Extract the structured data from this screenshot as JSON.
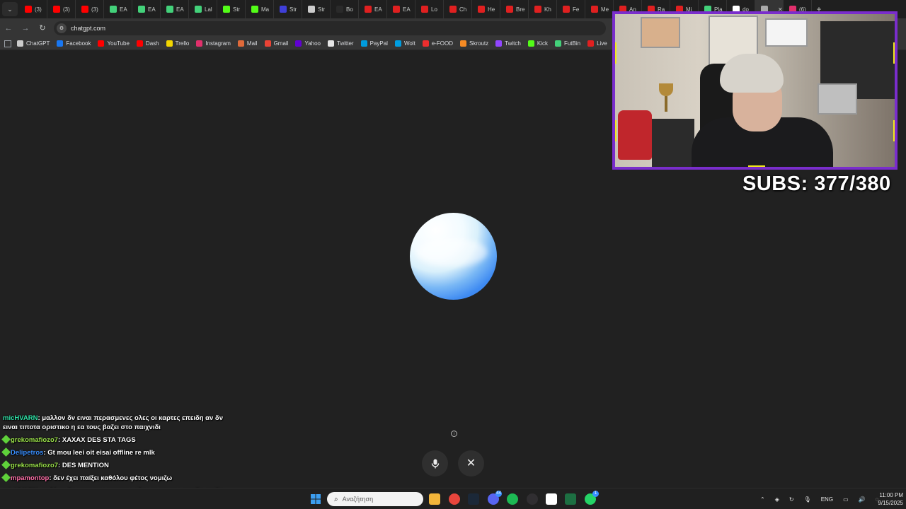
{
  "browser": {
    "tabs": [
      {
        "label": "(3)",
        "color": "#ff0000",
        "icon": "youtube-icon"
      },
      {
        "label": "(3)",
        "color": "#ff0000",
        "icon": "youtube-icon"
      },
      {
        "label": "(3)",
        "color": "#ff0000",
        "icon": "youtube-icon"
      },
      {
        "label": "EA",
        "color": "#43d17a",
        "icon": "futbin-icon"
      },
      {
        "label": "EA",
        "color": "#43d17a",
        "icon": "futbin-icon"
      },
      {
        "label": "EA",
        "color": "#43d17a",
        "icon": "futbin-icon"
      },
      {
        "label": "Lal",
        "color": "#43d17a",
        "icon": "futbin-icon"
      },
      {
        "label": "Str",
        "color": "#53fc18",
        "icon": "kick-icon"
      },
      {
        "label": "Ma",
        "color": "#53fc18",
        "icon": "kick-icon"
      },
      {
        "label": "Str",
        "color": "#3f3fd8",
        "icon": "stream-icon"
      },
      {
        "label": "Str",
        "color": "#cccccc",
        "icon": "stream-icon"
      },
      {
        "label": "Bo",
        "color": "#2a2a2a",
        "icon": "blank-icon"
      },
      {
        "label": "EA",
        "color": "#e02020",
        "icon": "ea-icon"
      },
      {
        "label": "EA",
        "color": "#e02020",
        "icon": "ea-icon"
      },
      {
        "label": "Lo",
        "color": "#e02020",
        "icon": "ea-icon"
      },
      {
        "label": "Ch",
        "color": "#e02020",
        "icon": "ea-icon"
      },
      {
        "label": "He",
        "color": "#e02020",
        "icon": "ea-icon"
      },
      {
        "label": "Bre",
        "color": "#e02020",
        "icon": "ea-icon"
      },
      {
        "label": "Kh",
        "color": "#e02020",
        "icon": "ea-icon"
      },
      {
        "label": "Fe",
        "color": "#e02020",
        "icon": "ea-icon"
      },
      {
        "label": "Me",
        "color": "#e02020",
        "icon": "ea-icon"
      },
      {
        "label": "An",
        "color": "#e02020",
        "icon": "ea-icon"
      },
      {
        "label": "Ra",
        "color": "#e02020",
        "icon": "ea-icon"
      },
      {
        "label": "Mi",
        "color": "#e02020",
        "icon": "ea-icon"
      },
      {
        "label": "Pla",
        "color": "#43d17a",
        "icon": "futbin-icon"
      },
      {
        "label": "do",
        "color": "#ffffff",
        "icon": "google-icon"
      },
      {
        "label": "",
        "color": "#aaaaaa",
        "icon": "chatgpt-icon",
        "active": true
      },
      {
        "label": "(6)",
        "color": "#e1306c",
        "icon": "instagram-icon"
      }
    ],
    "close_glyph": "✕",
    "new_tab_glyph": "+",
    "tab_menu_glyph": "⌄",
    "nav": {
      "back": "←",
      "forward": "→",
      "reload": "↻"
    },
    "url": "chatgpt.com",
    "bookmarks": [
      {
        "label": "ChatGPT",
        "color": "#cccccc",
        "icon": "chatgpt-icon"
      },
      {
        "label": "Facebook",
        "color": "#1877f2",
        "icon": "facebook-icon"
      },
      {
        "label": "YouTube",
        "color": "#ff0000",
        "icon": "youtube-icon"
      },
      {
        "label": "Dash",
        "color": "#ff0000",
        "icon": "youtube-icon"
      },
      {
        "label": "Trello",
        "color": "#f2d600",
        "icon": "trello-icon"
      },
      {
        "label": "Instagram",
        "color": "#e1306c",
        "icon": "instagram-icon"
      },
      {
        "label": "Mail",
        "color": "#e06a3a",
        "icon": "mail-icon"
      },
      {
        "label": "Gmail",
        "color": "#ea4335",
        "icon": "gmail-icon"
      },
      {
        "label": "Yahoo",
        "color": "#6001d2",
        "icon": "yahoo-icon"
      },
      {
        "label": "Twitter",
        "color": "#e6e6e6",
        "icon": "x-icon"
      },
      {
        "label": "PayPal",
        "color": "#009cde",
        "icon": "paypal-icon"
      },
      {
        "label": "Wolt",
        "color": "#009de0",
        "icon": "wolt-icon"
      },
      {
        "label": "e-FOOD",
        "color": "#ed2e2e",
        "icon": "efood-icon"
      },
      {
        "label": "Skroutz",
        "color": "#f68b24",
        "icon": "skroutz-icon"
      },
      {
        "label": "Twitch",
        "color": "#9146ff",
        "icon": "twitch-icon"
      },
      {
        "label": "Kick",
        "color": "#53fc18",
        "icon": "kick-icon"
      },
      {
        "label": "FutBin",
        "color": "#43d17a",
        "icon": "futbin-icon"
      },
      {
        "label": "Live",
        "color": "#e02020",
        "icon": "live-icon"
      }
    ]
  },
  "overlay": {
    "subs_text": "SUBS: 377/380",
    "frame_color": "#7a2dcc",
    "corner_color": "#f2ea1c"
  },
  "voice": {
    "info_glyph": "i",
    "close_glyph": "✕"
  },
  "chat": [
    {
      "user": "micHVARN",
      "user_color": "#2fe3a8",
      "badge": false,
      "text": "μαλλον δν ειναι περασμενες ολες οι καρτες επειδη αν δν ειναι τιποτα οριστικο η εα τους βαζει στο παιχνιδι"
    },
    {
      "user": "grekomafiozo7",
      "user_color": "#9be24a",
      "badge": true,
      "badge_color": "#5fd13a",
      "text": "XAXAX DES STA TAGS"
    },
    {
      "user": "Delipetros",
      "user_color": "#3a8fff",
      "badge": true,
      "badge_color": "#5fd13a",
      "text": "Gt mou leei oit eisai offline re mlk"
    },
    {
      "user": "grekomafiozo7",
      "user_color": "#9be24a",
      "badge": true,
      "badge_color": "#5fd13a",
      "text": "DES MENTION"
    },
    {
      "user": "mpamontop",
      "user_color": "#ff6fa8",
      "badge": true,
      "badge_color": "#5fd13a",
      "text": "δεν έχει παίξει καθόλου φέτος νομιζω"
    },
    {
      "user": "micHVARN",
      "user_color": "#2fe3a8",
      "badge": false,
      "text": "μαλλον δν ειναι περασμενες ολες οι καρτες επειδη αν δν ειναι τιποτα οριστικο η εα τους βαζει στο παιχνιδι"
    }
  ],
  "taskbar": {
    "search_placeholder": "Αναζήτηση",
    "search_glyph": "⌕",
    "language": "ENG",
    "time": "11:00 PM",
    "date": "9/15/2025",
    "apps": [
      {
        "name": "windows-start-icon",
        "color": "#3c9ef0"
      },
      {
        "name": "file-explorer-icon",
        "color": "#f2b53a"
      },
      {
        "name": "chrome-icon",
        "color": "#e8453c"
      },
      {
        "name": "steam-icon",
        "color": "#1b2838"
      },
      {
        "name": "discord-icon",
        "color": "#5865f2",
        "badge": "44"
      },
      {
        "name": "spotify-icon",
        "color": "#1db954"
      },
      {
        "name": "obs-icon",
        "color": "#302e31"
      },
      {
        "name": "capcut-icon",
        "color": "#ffffff"
      },
      {
        "name": "excel-icon",
        "color": "#1d6f42"
      },
      {
        "name": "whatsapp-icon",
        "color": "#25d366",
        "badge": "1"
      }
    ]
  }
}
